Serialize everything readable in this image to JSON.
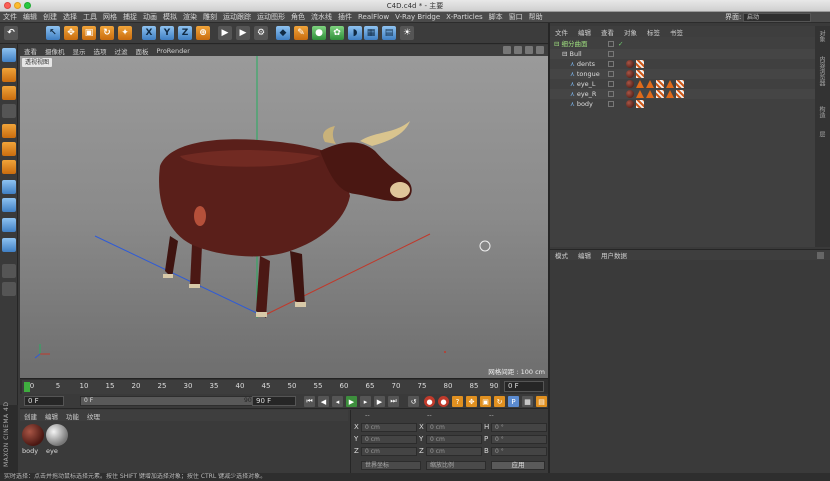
{
  "window": {
    "title": "C4D.c4d * - 主要"
  },
  "menu": {
    "items": [
      "文件",
      "编辑",
      "创建",
      "选择",
      "工具",
      "网格",
      "捕捉",
      "动画",
      "模拟",
      "渲染",
      "雕刻",
      "运动跟踪",
      "运动图形",
      "角色",
      "流水线",
      "插件",
      "RealFlow",
      "V-Ray Bridge",
      "X-Particles",
      "脚本",
      "窗口",
      "帮助"
    ],
    "layout_label": "界面:",
    "layout_value": "启动"
  },
  "viewport": {
    "menu": [
      "查看",
      "摄像机",
      "显示",
      "选项",
      "过滤",
      "面板",
      "ProRender"
    ],
    "camera_label": "透视视图",
    "grid_label": "网格间距 : 100 cm"
  },
  "timeline": {
    "ticks": [
      "0",
      "5",
      "10",
      "15",
      "20",
      "25",
      "30",
      "35",
      "40",
      "45",
      "50",
      "55",
      "60",
      "65",
      "70",
      "75",
      "80",
      "85",
      "90"
    ],
    "current_frame": "0 F"
  },
  "transport": {
    "start_field": "0 F",
    "range_start": "0 F",
    "range_end": "90 F",
    "end_field": "90 F"
  },
  "material_manager": {
    "menu": [
      "创建",
      "编辑",
      "功能",
      "纹理"
    ],
    "materials": [
      {
        "name": "body",
        "color": "#6b2a22"
      },
      {
        "name": "eye",
        "color": "#b0b0b0"
      }
    ]
  },
  "maxon_logo": "MAXON CINEMA 4D",
  "coordinates": {
    "headers": [
      "--",
      "--",
      "--"
    ],
    "rows": [
      {
        "a": "X",
        "av": "0 cm",
        "b": "X",
        "bv": "0 cm",
        "c": "H",
        "cv": "0 °"
      },
      {
        "a": "Y",
        "av": "0 cm",
        "b": "Y",
        "bv": "0 cm",
        "c": "P",
        "cv": "0 °"
      },
      {
        "a": "Z",
        "av": "0 cm",
        "b": "Z",
        "bv": "0 cm",
        "c": "B",
        "cv": "0 °"
      }
    ],
    "space_select": "世界坐标",
    "scale_select": "缩放比例",
    "apply_label": "应用"
  },
  "object_manager": {
    "menu": [
      "文件",
      "编辑",
      "查看",
      "对象",
      "标签",
      "书签"
    ],
    "objects": [
      {
        "name": "细分曲面",
        "indent": 0,
        "tags": []
      },
      {
        "name": "Bull",
        "indent": 1,
        "tags": []
      },
      {
        "name": "dents",
        "indent": 2,
        "tags": [
          "mat",
          "chk"
        ]
      },
      {
        "name": "tongue",
        "indent": 2,
        "tags": [
          "mat",
          "chk"
        ]
      },
      {
        "name": "eye_L",
        "indent": 2,
        "tags": [
          "mat",
          "tri",
          "tri",
          "chk",
          "tri",
          "chk"
        ]
      },
      {
        "name": "eye_R",
        "indent": 2,
        "tags": [
          "mat",
          "tri",
          "tri",
          "chk",
          "tri",
          "chk"
        ]
      },
      {
        "name": "body",
        "indent": 2,
        "tags": [
          "mat",
          "chk"
        ]
      }
    ],
    "side_tabs": [
      "对象",
      "内容浏览器",
      "构造",
      "层"
    ]
  },
  "attribute_manager": {
    "menu": [
      "模式",
      "编辑",
      "用户数据"
    ]
  },
  "status_bar": "实时选择：点击并拖动鼠标选择元素。按住 SHIFT 键增加选择对象；按住 CTRL 键减少选择对象。",
  "colors": {
    "accent_orange": "#e08a1e",
    "accent_blue": "#5b9bd5",
    "axis_x": "#c0392b",
    "axis_y": "#27ae60",
    "axis_z": "#2e5bd8",
    "bull_body": "#5a1f1a"
  }
}
